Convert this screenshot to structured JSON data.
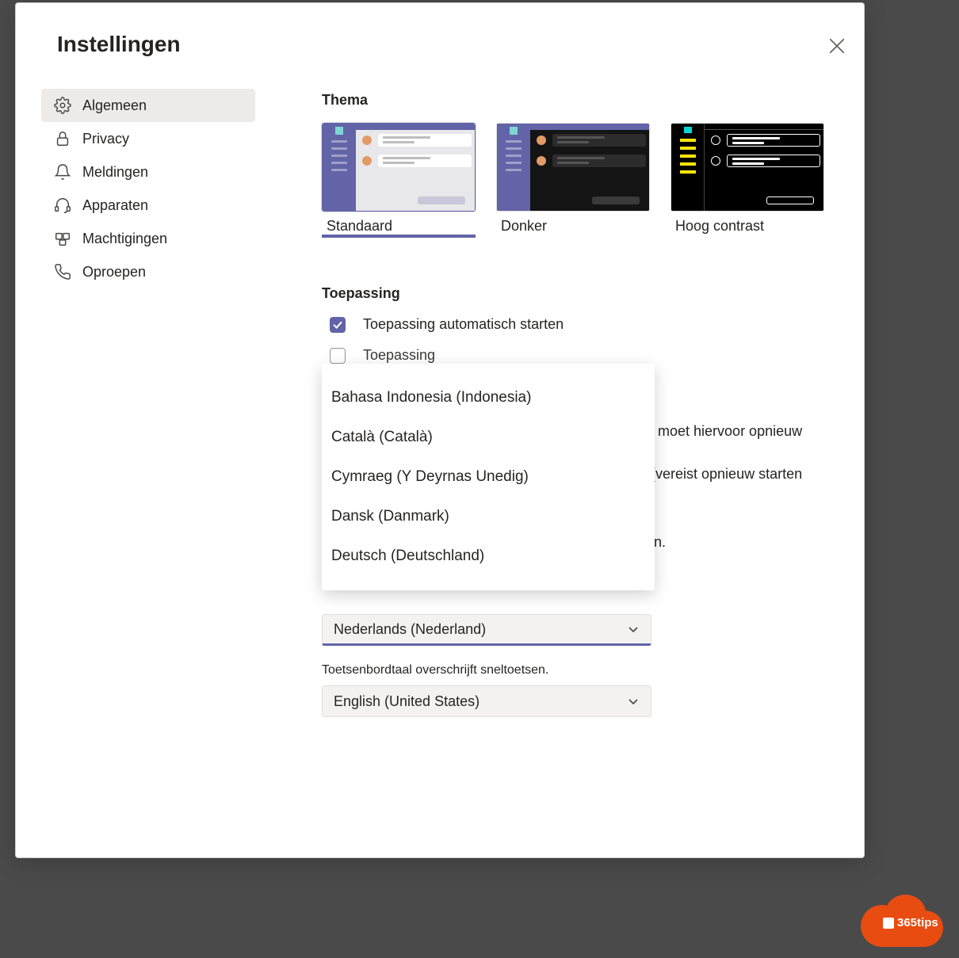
{
  "header": {
    "title": "Instellingen"
  },
  "sidebar": {
    "items": [
      {
        "label": "Algemeen",
        "icon": "gear-icon",
        "active": true
      },
      {
        "label": "Privacy",
        "icon": "lock-icon"
      },
      {
        "label": "Meldingen",
        "icon": "bell-icon"
      },
      {
        "label": "Apparaten",
        "icon": "headset-icon"
      },
      {
        "label": "Machtigingen",
        "icon": "key-icon"
      },
      {
        "label": "Oproepen",
        "icon": "phone-icon"
      }
    ]
  },
  "theme": {
    "section_title": "Thema",
    "options": [
      {
        "label": "Standaard",
        "selected": true
      },
      {
        "label": "Donker"
      },
      {
        "label": "Hoog contrast"
      }
    ]
  },
  "application": {
    "section_title": "Toepassing",
    "rows": [
      {
        "label": "Toepassing automatisch starten",
        "checked": true
      },
      {
        "label_partial": "Toepassing"
      }
    ],
    "hint_right_1": "ns moet hiervoor opnieuw",
    "hint_right_2": "e (vereist opnieuw starten",
    "hint_right_3": "sen."
  },
  "language": {
    "dropdown_options": [
      "Bahasa Indonesia (Indonesia)",
      "Català (Català)",
      "Cymraeg (Y Deyrnas Unedig)",
      "Dansk (Danmark)",
      "Deutsch (Deutschland)"
    ],
    "app_language_selected": "Nederlands (Nederland)",
    "keyboard_hint": "Toetsenbordtaal overschrijft sneltoetsen.",
    "keyboard_language_selected": "English (United States)"
  },
  "logo": {
    "text": "365tips"
  },
  "colors": {
    "accent": "#6264a7",
    "sidebar_active_bg": "#edebe9",
    "logo_orange": "#e84c10"
  }
}
